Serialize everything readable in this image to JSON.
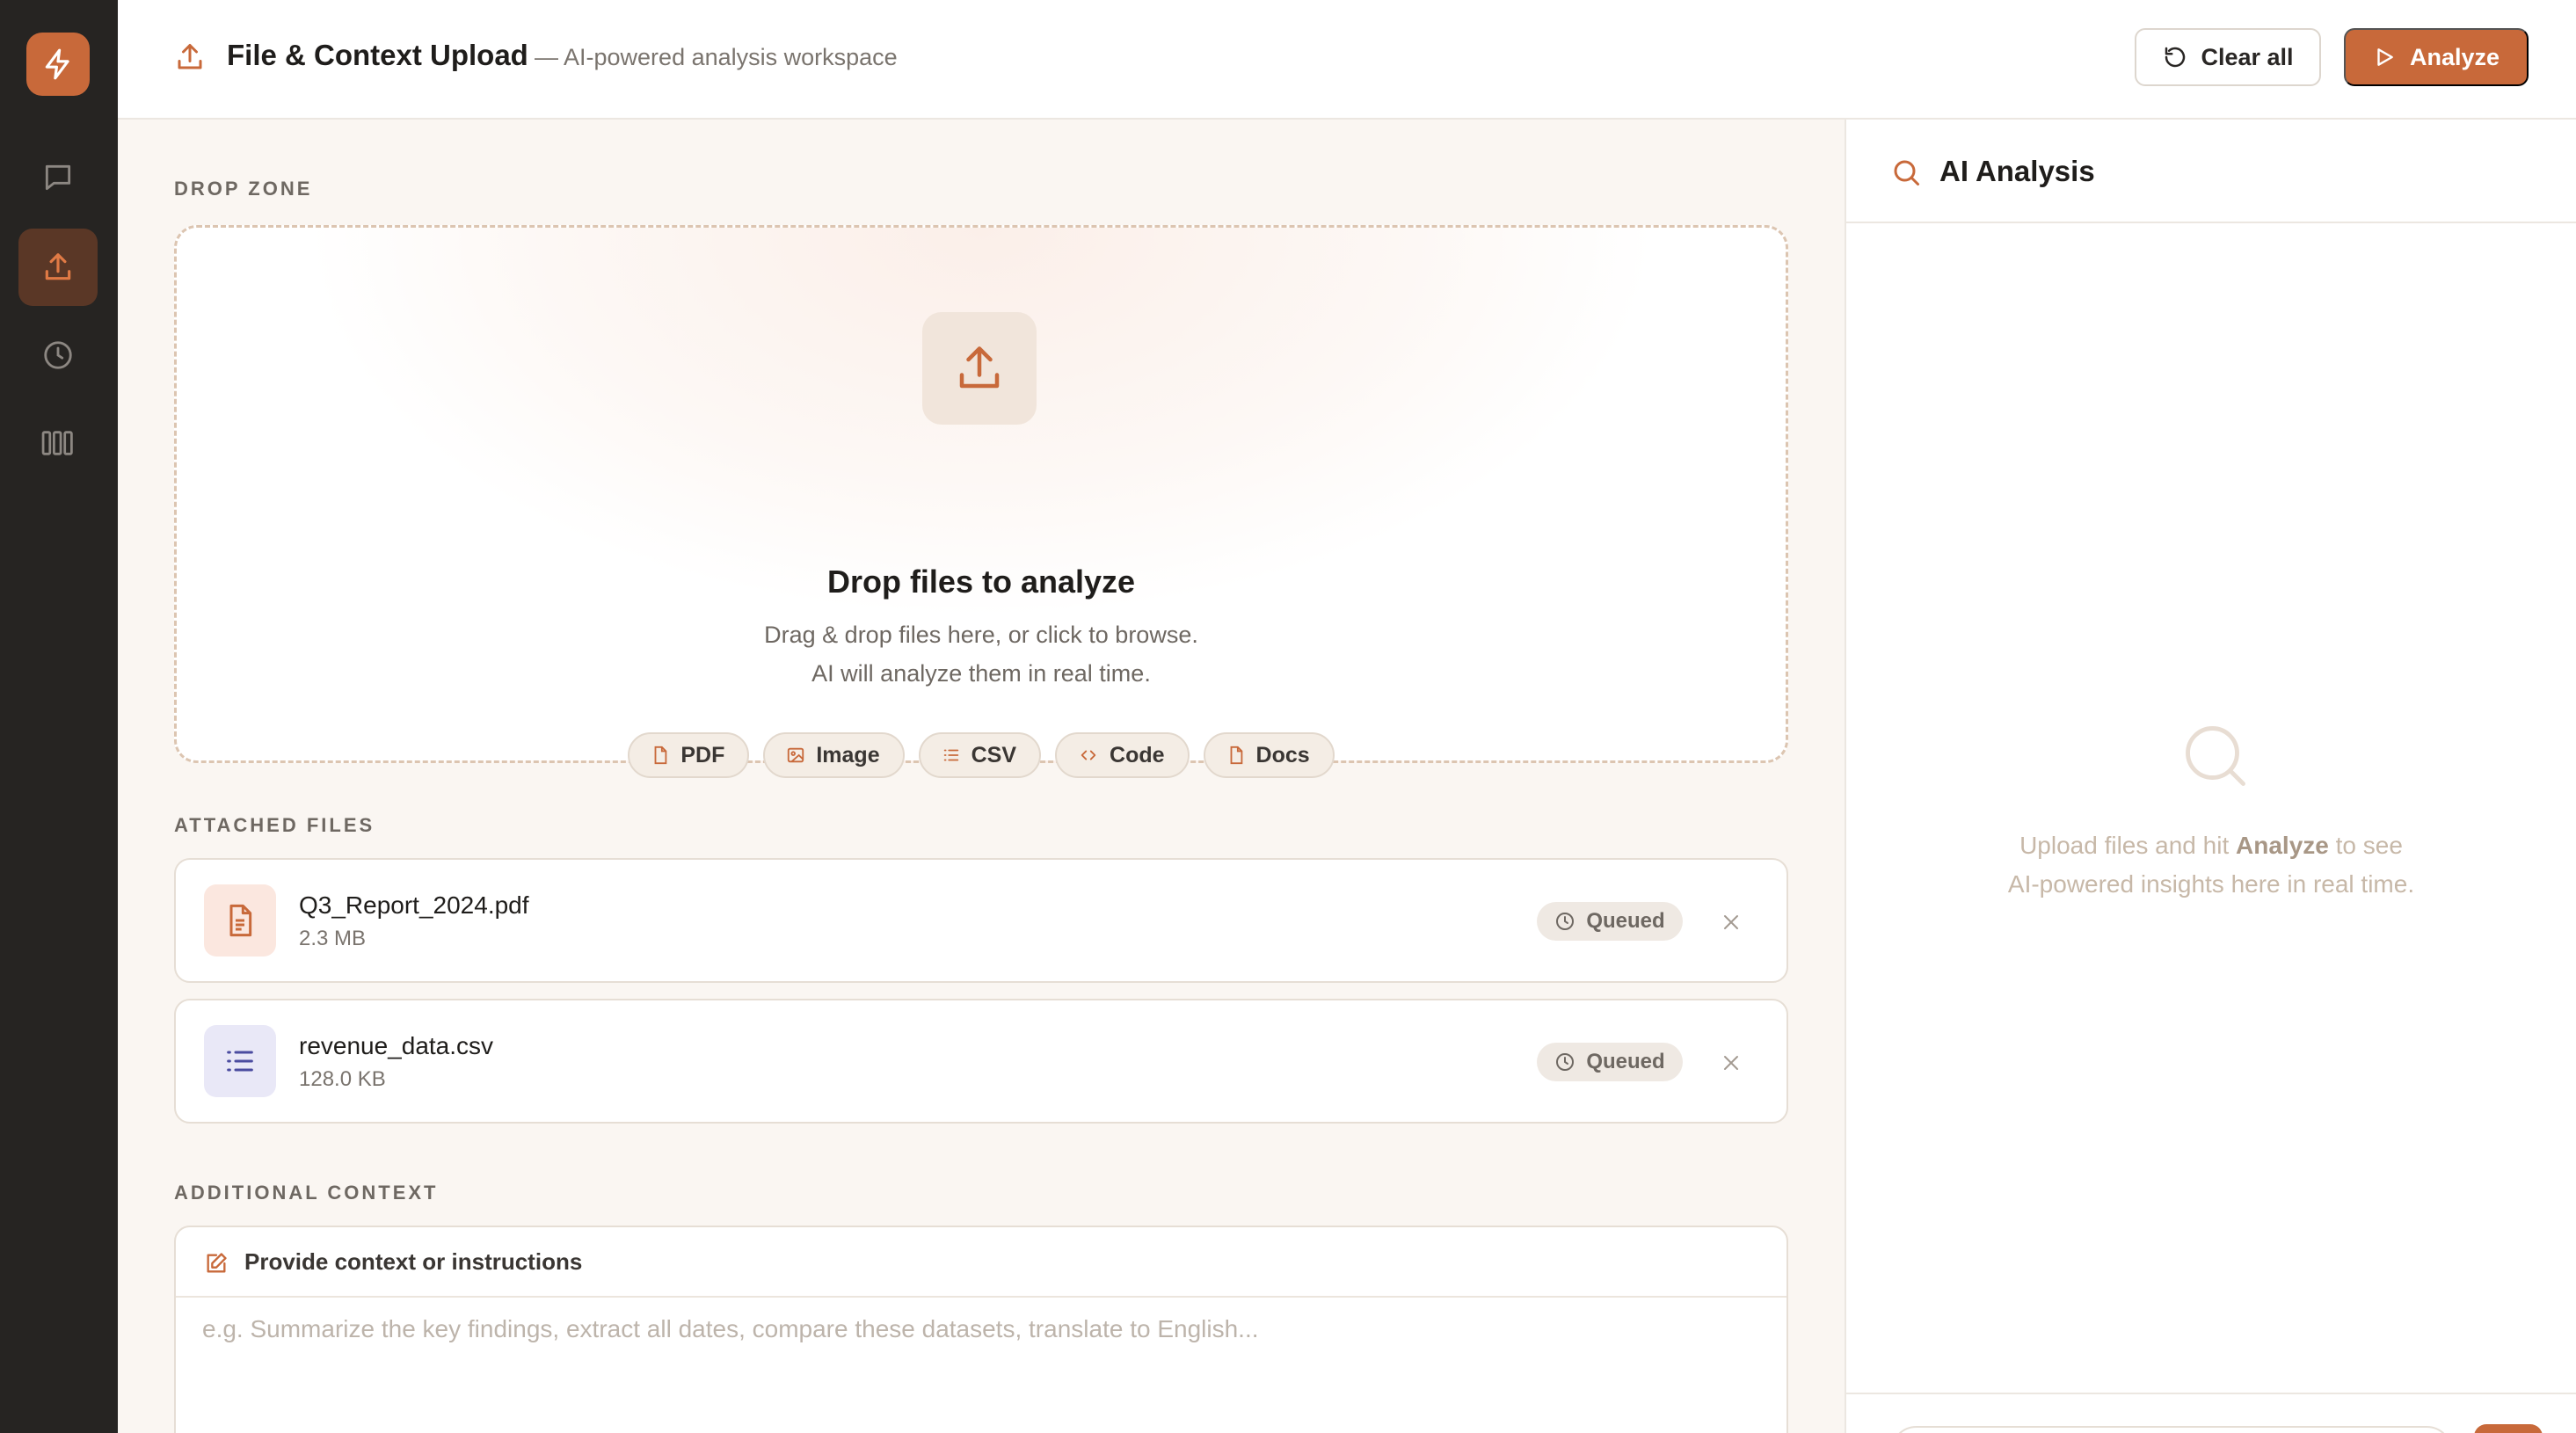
{
  "header": {
    "title": "File & Context Upload",
    "subtitle": "— AI-powered analysis workspace",
    "clear_label": "Clear all",
    "analyze_label": "Analyze"
  },
  "sidebar": {
    "items": [
      {
        "name": "logo",
        "icon": "bolt-icon"
      },
      {
        "name": "chat",
        "icon": "chat-icon"
      },
      {
        "name": "upload",
        "icon": "upload-icon",
        "active": true
      },
      {
        "name": "history",
        "icon": "clock-icon"
      },
      {
        "name": "library",
        "icon": "library-icon"
      }
    ]
  },
  "dropzone": {
    "section_label": "DROP ZONE",
    "title": "Drop files to analyze",
    "desc_line1": "Drag & drop files here, or click to browse.",
    "desc_line2": "AI will analyze them in real time.",
    "types": [
      {
        "label": "PDF",
        "icon": "file-icon"
      },
      {
        "label": "Image",
        "icon": "image-icon"
      },
      {
        "label": "CSV",
        "icon": "list-icon"
      },
      {
        "label": "Code",
        "icon": "code-icon"
      },
      {
        "label": "Docs",
        "icon": "file-icon"
      }
    ]
  },
  "attached": {
    "section_label": "ATTACHED FILES",
    "files": [
      {
        "name": "Q3_Report_2024.pdf",
        "size": "2.3 MB",
        "status": "Queued",
        "icon": "document-icon"
      },
      {
        "name": "revenue_data.csv",
        "size": "128.0 KB",
        "status": "Queued",
        "icon": "list-icon"
      }
    ]
  },
  "context": {
    "section_label": "ADDITIONAL CONTEXT",
    "header_label": "Provide context or instructions",
    "placeholder": "e.g. Summarize the key findings, extract all dates, compare these datasets, translate to English..."
  },
  "analysis": {
    "title": "AI Analysis",
    "empty_pre": "Upload files and hit ",
    "empty_bold": "Analyze",
    "empty_post": " to see",
    "empty_line2": "AI-powered insights here in real time."
  },
  "colors": {
    "accent": "#c8693a",
    "rail_bg": "#262422",
    "main_bg": "#faf6f2",
    "pdf_thumb": "#fbe7df",
    "csv_thumb": "#e9e8f7"
  }
}
